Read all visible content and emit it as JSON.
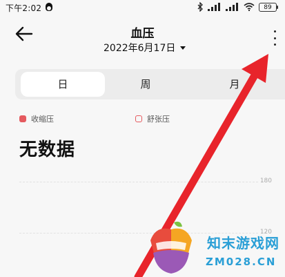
{
  "status_bar": {
    "time": "下午2:02",
    "battery": "89"
  },
  "header": {
    "title": "血压",
    "date": "2022年6月17日"
  },
  "tabs": [
    {
      "label": "日",
      "selected": true
    },
    {
      "label": "周",
      "selected": false
    },
    {
      "label": "月",
      "selected": false
    }
  ],
  "legend": {
    "systolic": "收缩压",
    "diastolic": "舒张压"
  },
  "empty_state": "无数据",
  "chart": {
    "ticks": [
      "180",
      "120"
    ]
  },
  "watermark": {
    "name": "知末游戏网",
    "url": "ZM028.CN"
  },
  "colors": {
    "accent": "#e55a5f",
    "annotation": "#e8242b",
    "watermark": "#2a9fd6"
  }
}
